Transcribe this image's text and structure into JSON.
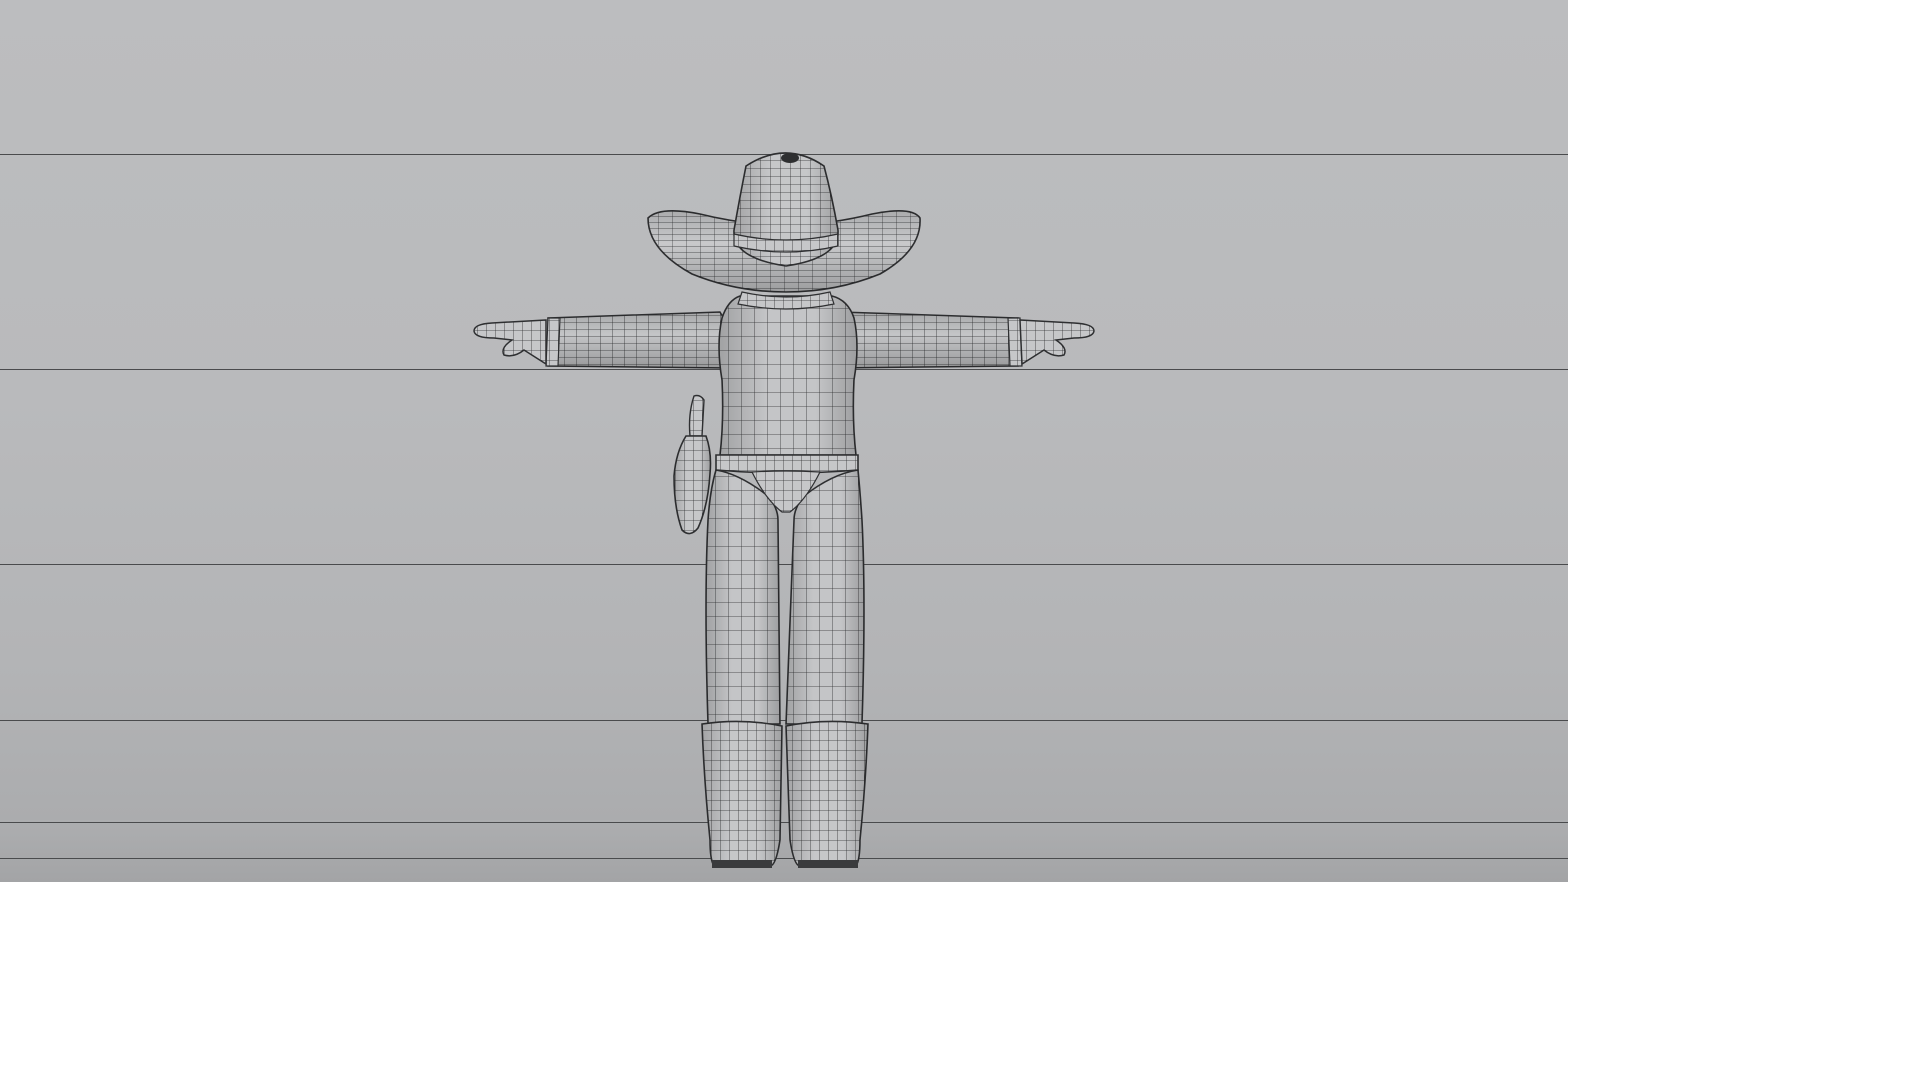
{
  "viewport": {
    "background_color": "#b9babc",
    "guide_line_color": "#4a4b4d",
    "wireframe_color": "#2e2f31",
    "shaded_surface_color": "#c4c5c7"
  },
  "model": {
    "pose": "T-pose",
    "display_mode": "wireframe-on-shaded",
    "parts": [
      "hat",
      "head",
      "torso",
      "left-arm",
      "right-arm",
      "belt",
      "holster",
      "left-leg",
      "right-leg",
      "left-boot",
      "right-boot"
    ]
  }
}
